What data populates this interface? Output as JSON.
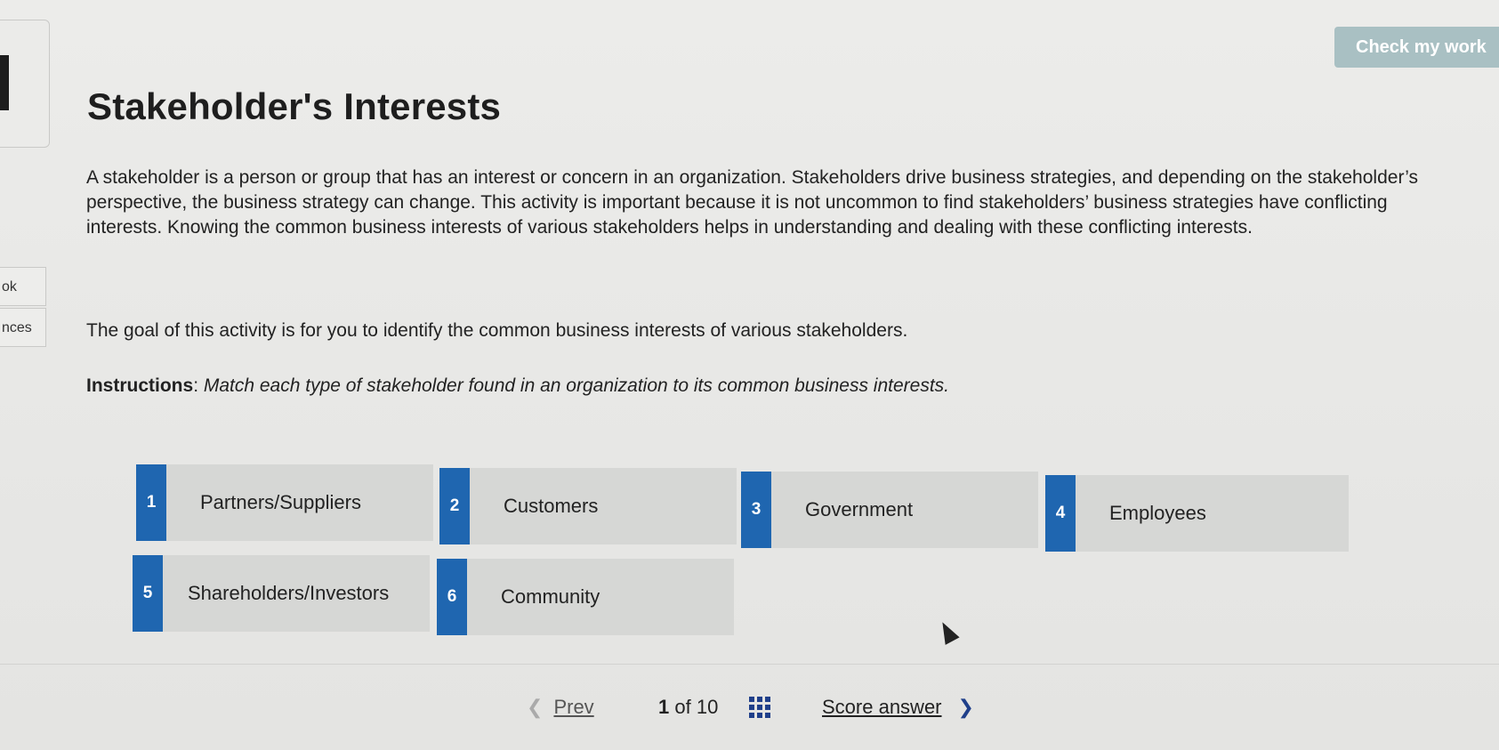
{
  "sidebar": {
    "tabs": [
      {
        "label": "ok"
      },
      {
        "label": "nces"
      }
    ]
  },
  "toolbar": {
    "check_label": "Check my work"
  },
  "main": {
    "title": "Stakeholder's Interests",
    "intro": "A stakeholder is a person or group that has an interest or concern in an organization. Stakeholders drive business strategies, and depending on the stakeholder’s perspective, the business strategy can change. This activity is important because it is not uncommon to find stakeholders’ business strategies have conflicting interests. Knowing the common business interests of various stakeholders helps in understanding and dealing with these conflicting interests.",
    "goal": "The goal of this activity is for you to identify the common business interests of various stakeholders.",
    "instructions_lead": "Instructions",
    "instructions_sep": ": ",
    "instructions_text": "Match each type of stakeholder found in an organization to its common business interests."
  },
  "cards": [
    {
      "number": "1",
      "label": "Partners/Suppliers"
    },
    {
      "number": "2",
      "label": "Customers"
    },
    {
      "number": "3",
      "label": "Government"
    },
    {
      "number": "4",
      "label": "Employees"
    },
    {
      "number": "5",
      "label": "Shareholders/Investors"
    },
    {
      "number": "6",
      "label": "Community"
    }
  ],
  "footer": {
    "prev_label": "Prev",
    "page_current": "1",
    "page_of": "of 10",
    "score_label": "Score answer"
  },
  "colors": {
    "badge_blue": "#1f66b0",
    "card_bg": "#d6d7d5",
    "check_btn": "#a9c0c3",
    "nav_accent": "#1f3f8a"
  },
  "icons": [
    "chevron-left-icon",
    "grid-icon",
    "chevron-right-icon",
    "mouse-cursor-icon"
  ]
}
